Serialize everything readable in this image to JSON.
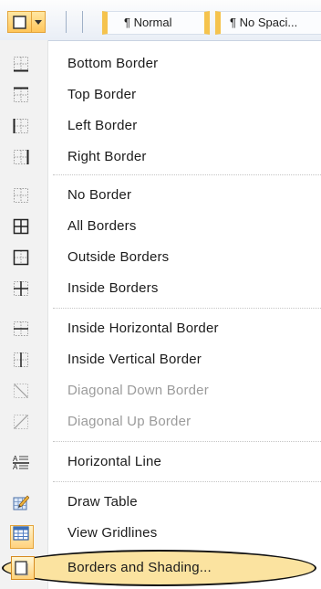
{
  "toolbar": {
    "borders_button_icon": "border-icon",
    "dropdown_icon": "chevron-down-icon",
    "style_normal": "¶ Normal",
    "style_no_spacing": "¶ No Spaci..."
  },
  "menu": {
    "items": [
      {
        "label": "Bottom Border",
        "icon": "bottom-border-icon",
        "enabled": true
      },
      {
        "label": "Top Border",
        "icon": "top-border-icon",
        "enabled": true
      },
      {
        "label": "Left Border",
        "icon": "left-border-icon",
        "enabled": true
      },
      {
        "label": "Right Border",
        "icon": "right-border-icon",
        "enabled": true
      },
      {
        "label": "No Border",
        "icon": "no-border-icon",
        "enabled": true
      },
      {
        "label": "All Borders",
        "icon": "all-borders-icon",
        "enabled": true
      },
      {
        "label": "Outside Borders",
        "icon": "outside-borders-icon",
        "enabled": true
      },
      {
        "label": "Inside Borders",
        "icon": "inside-borders-icon",
        "enabled": true
      },
      {
        "label": "Inside Horizontal Border",
        "icon": "inside-horizontal-border-icon",
        "enabled": true
      },
      {
        "label": "Inside Vertical Border",
        "icon": "inside-vertical-border-icon",
        "enabled": true
      },
      {
        "label": "Diagonal Down Border",
        "icon": "diagonal-down-border-icon",
        "enabled": false
      },
      {
        "label": "Diagonal Up Border",
        "icon": "diagonal-up-border-icon",
        "enabled": false
      },
      {
        "label": "Horizontal Line",
        "icon": "horizontal-line-icon",
        "enabled": true
      },
      {
        "label": "Draw Table",
        "icon": "draw-table-icon",
        "enabled": true
      },
      {
        "label": "View Gridlines",
        "icon": "view-gridlines-icon",
        "enabled": true
      },
      {
        "label": "Borders and Shading...",
        "icon": "borders-shading-icon",
        "enabled": true,
        "highlighted": true
      }
    ]
  }
}
